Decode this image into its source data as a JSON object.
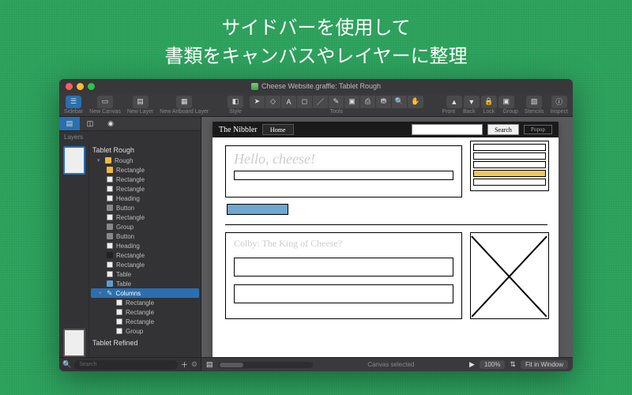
{
  "promo": {
    "line1": "サイドバーを使用して",
    "line2": "書類をキャンバスやレイヤーに整理"
  },
  "window": {
    "title": "Cheese Website.graffle: Tablet Rough"
  },
  "toolbar": {
    "sidebar": "Sidebar",
    "new_canvas": "New Canvas",
    "new_layer": "New Layer",
    "new_artboard_layer": "New Artboard Layer",
    "style": "Style",
    "tools": "Tools",
    "front": "Front",
    "back": "Back",
    "lock": "Lock",
    "group": "Group",
    "stencils": "Stencils",
    "inspect": "Inspect"
  },
  "sidebar": {
    "header": "Layers",
    "canvases": [
      "Tablet Rough",
      "Tablet Refined"
    ],
    "group_rough": "Rough",
    "selected": "Columns",
    "items": [
      {
        "label": "Rectangle",
        "color": "yellow"
      },
      {
        "label": "Rectangle",
        "color": "white"
      },
      {
        "label": "Rectangle",
        "color": "white"
      },
      {
        "label": "Heading",
        "color": "white"
      },
      {
        "label": "Button",
        "color": "grey"
      },
      {
        "label": "Rectangle",
        "color": "white"
      },
      {
        "label": "Group",
        "color": "grey"
      },
      {
        "label": "Button",
        "color": "grey"
      },
      {
        "label": "Heading",
        "color": "white"
      },
      {
        "label": "Rectangle",
        "color": "black"
      },
      {
        "label": "Rectangle",
        "color": "white"
      },
      {
        "label": "Table",
        "color": "white"
      },
      {
        "label": "Table",
        "color": "blue"
      }
    ],
    "post_selected": [
      {
        "label": "Rectangle"
      },
      {
        "label": "Rectangle"
      },
      {
        "label": "Rectangle"
      },
      {
        "label": "Group"
      }
    ],
    "search_placeholder": "Search"
  },
  "canvas": {
    "brand": "The Nibbler",
    "nav_home": "Home",
    "search_btn": "Search",
    "popup": "Popup",
    "hello": "Hello, cheese!",
    "colby": "Colby: The King of Cheese?"
  },
  "footer": {
    "status": "Canvas selected",
    "zoom": "100%",
    "fit": "Fit in Window"
  }
}
